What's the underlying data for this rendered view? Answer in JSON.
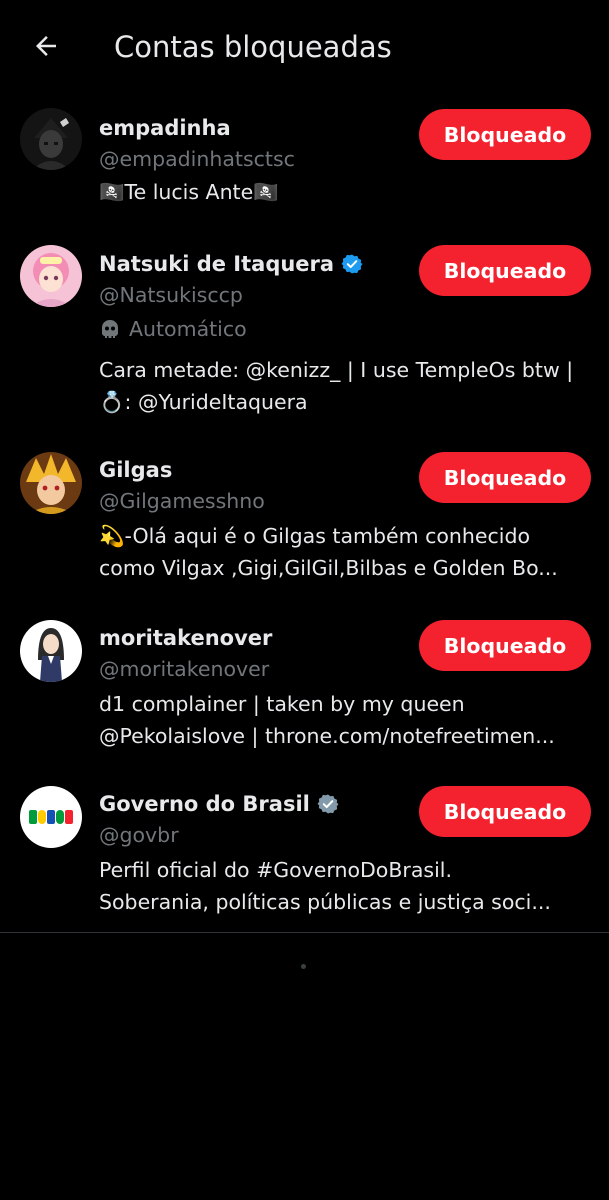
{
  "header": {
    "title": "Contas bloqueadas",
    "back_icon": "arrow-left-icon"
  },
  "accounts": [
    {
      "name": "empadinha",
      "handle": "@empadinhatsctsc",
      "verified": false,
      "bio": [
        "🏴‍☠️Te lucis Ante🏴‍☠️"
      ],
      "button": "Bloqueado"
    },
    {
      "name": "Natsuki de Itaquera",
      "handle": "@Natsukisccp",
      "verified": true,
      "verified_color": "#1d9bf0",
      "automated_label": "Automático",
      "bio": [
        "Cara metade: @kenizz_ | I use TempleOs btw |",
        "💍: @YurideItaquera"
      ],
      "button": "Bloqueado"
    },
    {
      "name": "Gilgas",
      "handle": "@Gilgamesshno",
      "verified": false,
      "bio": [
        "💫-Olá aqui é o Gilgas também conhecido",
        "como Vilgax ,Gigi,GilGil,Bilbas e Golden Bo..."
      ],
      "button": "Bloqueado"
    },
    {
      "name": "moritakenover",
      "handle": "@moritakenover",
      "verified": false,
      "bio": [
        "d1 complainer | taken by my queen",
        "@Pekolaislove | throne.com/notefreetimen..."
      ],
      "button": "Bloqueado"
    },
    {
      "name": "Governo do Brasil",
      "handle": "@govbr",
      "verified": true,
      "verified_color": "#829aab",
      "bio": [
        "Perfil oficial do #GovernoDoBrasil.",
        "Soberania, políticas públicas e justiça soci..."
      ],
      "button": "Bloqueado"
    }
  ],
  "colors": {
    "background": "#000000",
    "block_button": "#f4212e",
    "secondary_text": "#71767b"
  }
}
